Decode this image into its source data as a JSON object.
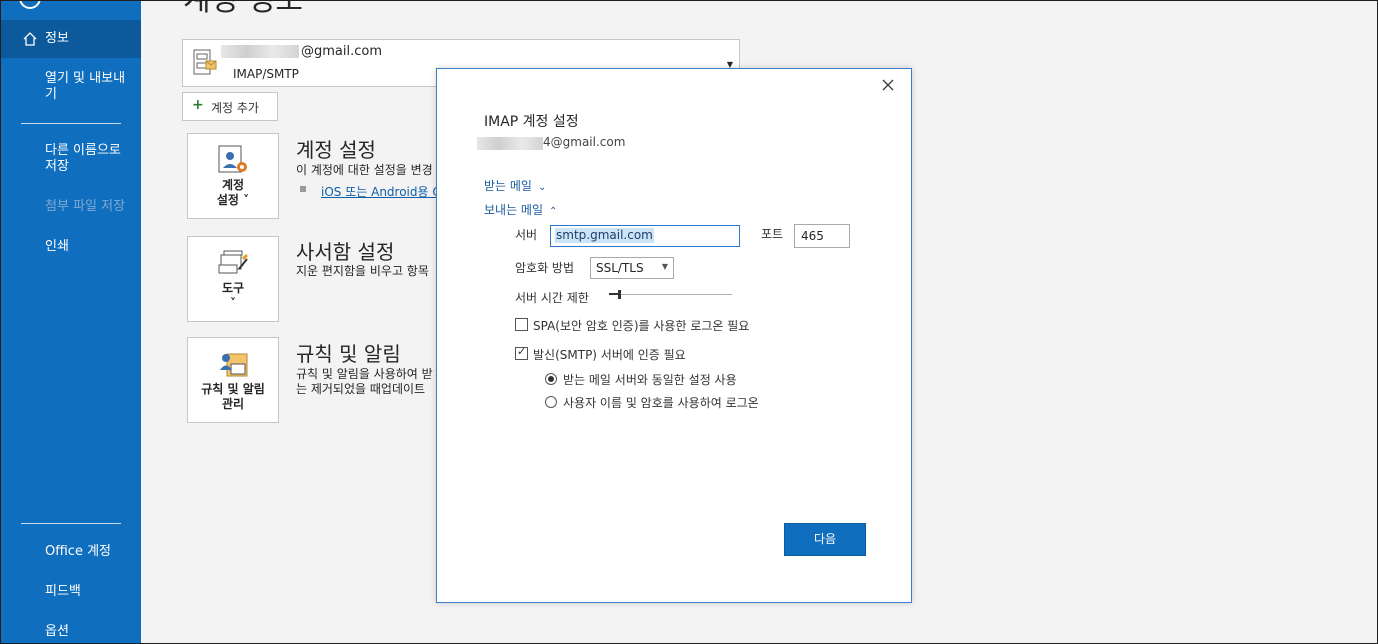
{
  "sidebar": {
    "items": [
      {
        "label": "정보",
        "active": true
      },
      {
        "label": "열기 및 내보내\n기"
      },
      {
        "label": "다른 이름으로\n저장"
      },
      {
        "label": "첨부 파일 저장",
        "disabled": true
      },
      {
        "label": "인쇄"
      },
      {
        "label": "Office 계정"
      },
      {
        "label": "피드백"
      },
      {
        "label": "옵션"
      }
    ]
  },
  "main": {
    "title_partial": "계정 정보",
    "account": {
      "email": "@gmail.com",
      "type": "IMAP/SMTP"
    },
    "add_account_label": "계정 추가",
    "sections": [
      {
        "tile_label": "계정\n설정 ˅",
        "heading": "계정 설정",
        "desc": "이 계정에 대한 설정을 변경",
        "link": "iOS 또는 Android용 O"
      },
      {
        "tile_label": "도구\n˅",
        "heading": "사서함 설정",
        "desc": "지운 편지함을 비우고 항목"
      },
      {
        "tile_label": "규칙 및 알림\n관리",
        "heading": "규칙 및 알림",
        "desc": "규칙 및 알림을 사용하여 받\n는 제거되었을 때업데이트"
      }
    ]
  },
  "dialog": {
    "title": "IMAP 계정 설정",
    "email": "4@gmail.com",
    "incoming_label": "받는 메일",
    "outgoing_label": "보내는 메일",
    "server_label": "서버",
    "server_value": "smtp.gmail.com",
    "port_label": "포트",
    "port_value": "465",
    "encryption_label": "암호화 방법",
    "encryption_value": "SSL/TLS",
    "timeout_label": "서버 시간 제한",
    "spa_label": "SPA(보안 암호 인증)를 사용한 로그온 필요",
    "spa_checked": false,
    "auth_label": "발신(SMTP) 서버에 인증 필요",
    "auth_checked": true,
    "radio_same": "받는 메일 서버와 동일한 설정 사용",
    "radio_login": "사용자 이름 및 암호를 사용하여 로그온",
    "next_label": "다음"
  },
  "colors": {
    "sidebar_bg": "#106ebe",
    "accent": "#106ebe",
    "link": "#0f5ea8"
  }
}
